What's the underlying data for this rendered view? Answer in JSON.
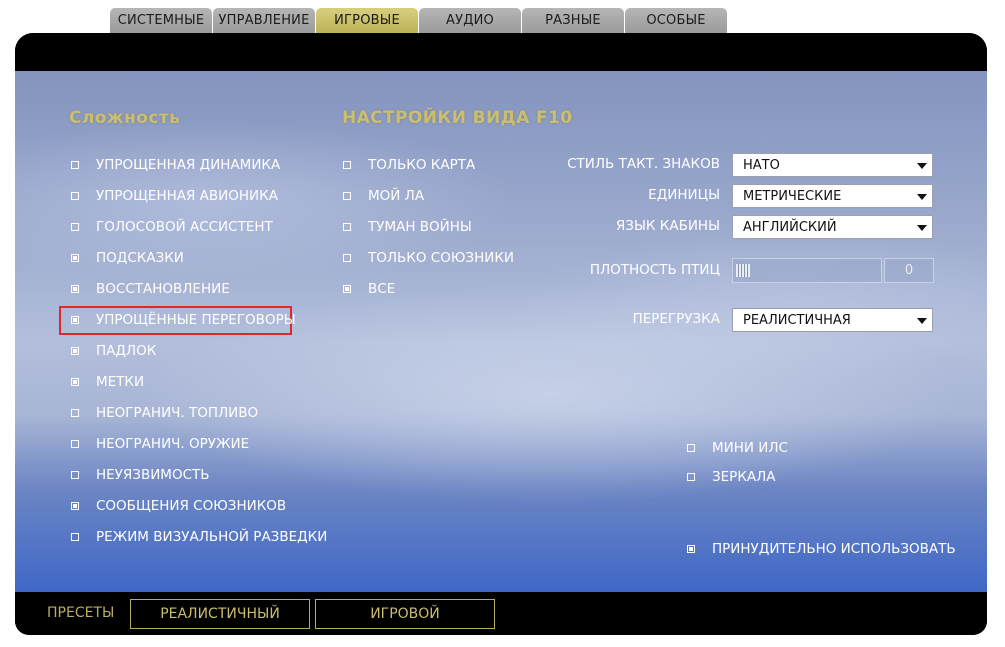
{
  "tabs": [
    {
      "label": "СИСТЕМНЫЕ",
      "active": false
    },
    {
      "label": "УПРАВЛЕНИЕ",
      "active": false
    },
    {
      "label": "ИГРОВЫЕ",
      "active": true
    },
    {
      "label": "АУДИО",
      "active": false
    },
    {
      "label": "РАЗНЫЕ",
      "active": false
    },
    {
      "label": "ОСОБЫЕ",
      "active": false
    }
  ],
  "colors": {
    "active_tab": "#c9bd66",
    "heading": "#cbbf6d",
    "highlight_border": "#e0282a"
  },
  "difficulty": {
    "heading": "Сложность",
    "items": [
      {
        "label": "УПРОЩЕННАЯ ДИНАМИКА",
        "checked": false
      },
      {
        "label": "УПРОЩЕННАЯ АВИОНИКА",
        "checked": false
      },
      {
        "label": "ГОЛОСОВОЙ АССИСТЕНТ",
        "checked": false
      },
      {
        "label": "ПОДСКАЗКИ",
        "checked": true
      },
      {
        "label": "ВОССТАНОВЛЕНИЕ",
        "checked": true
      },
      {
        "label": "УПРОЩЁННЫЕ ПЕРЕГОВОРЫ",
        "checked": true,
        "highlighted": true
      },
      {
        "label": "ПАДЛОК",
        "checked": true
      },
      {
        "label": "МЕТКИ",
        "checked": true
      },
      {
        "label": "НЕОГРАНИЧ. ТОПЛИВО",
        "checked": false
      },
      {
        "label": "НЕОГРАНИЧ. ОРУЖИЕ",
        "checked": false
      },
      {
        "label": "НЕУЯЗВИМОСТЬ",
        "checked": false
      },
      {
        "label": "СООБЩЕНИЯ СОЮЗНИКОВ",
        "checked": true
      },
      {
        "label": "РЕЖИМ ВИЗУАЛЬНОЙ РАЗВЕДКИ",
        "checked": false
      }
    ]
  },
  "f10": {
    "heading": "НАСТРОЙКИ ВИДА F10",
    "items": [
      {
        "label": "ТОЛЬКО КАРТА",
        "checked": false
      },
      {
        "label": "МОЙ ЛА",
        "checked": false
      },
      {
        "label": "ТУМАН ВОЙНЫ",
        "checked": false
      },
      {
        "label": "ТОЛЬКО СОЮЗНИКИ",
        "checked": false
      },
      {
        "label": "ВСЕ",
        "checked": true
      }
    ]
  },
  "settings": {
    "tact_symbols": {
      "label": "СТИЛЬ ТАКТ. ЗНАКОВ",
      "value": "НАТО"
    },
    "units": {
      "label": "ЕДИНИЦЫ",
      "value": "МЕТРИЧЕСКИЕ"
    },
    "cockpit_language": {
      "label": "ЯЗЫК КАБИНЫ",
      "value": "АНГЛИЙСКИЙ"
    },
    "bird_density": {
      "label": "ПЛОТНОСТЬ ПТИЦ",
      "value": "0",
      "level": 0
    },
    "g_effects": {
      "label": "ПЕРЕГРУЗКА",
      "value": "РЕАЛИСТИЧНАЯ"
    }
  },
  "extras": [
    {
      "label": "МИНИ ИЛС",
      "checked": false
    },
    {
      "label": "ЗЕРКАЛА",
      "checked": false
    },
    {
      "label": "ПРИНУДИТЕЛЬНО ИСПОЛЬЗОВАТЬ",
      "checked": true
    }
  ],
  "footer": {
    "presets_label": "ПРЕСЕТЫ",
    "realistic_button": "РЕАЛИСТИЧНЫЙ",
    "game_button": "ИГРОВОЙ"
  },
  "icons": {
    "dropdown": "chevron-down-icon",
    "checkbox": "checkbox-icon"
  }
}
